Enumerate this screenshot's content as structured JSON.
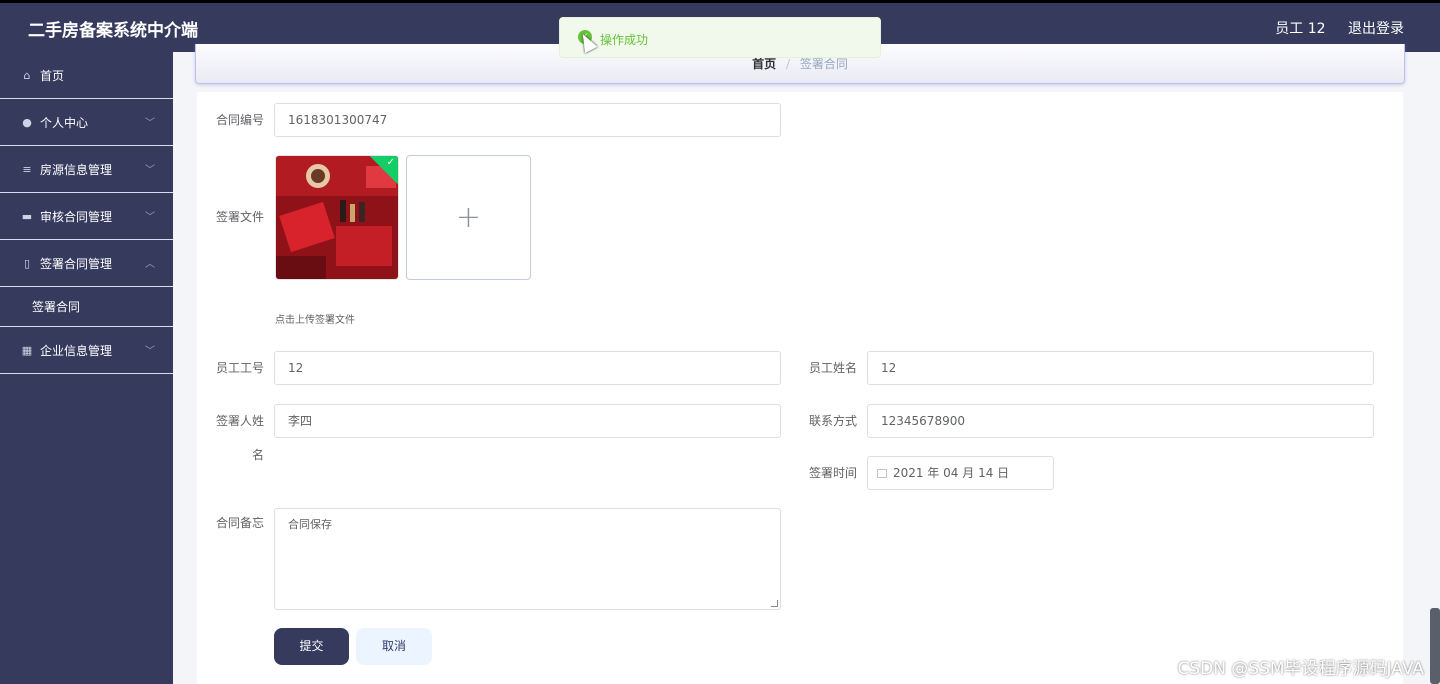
{
  "app": {
    "title": "二手房备案系统中介端"
  },
  "header": {
    "user": "员工 12",
    "logout": "退出登录"
  },
  "toast": {
    "message": "操作成功"
  },
  "sidebar": {
    "items": [
      {
        "label": "首页",
        "icon": "home-icon"
      },
      {
        "label": "个人中心",
        "icon": "user-icon"
      },
      {
        "label": "房源信息管理",
        "icon": "list-icon"
      },
      {
        "label": "审核合同管理",
        "icon": "briefcase-icon"
      },
      {
        "label": "签署合同管理",
        "icon": "microphone-icon"
      },
      {
        "label": "企业信息管理",
        "icon": "grid-icon"
      }
    ],
    "submenu": {
      "label": "签署合同"
    }
  },
  "breadcrumb": {
    "home": "首页",
    "separator": "/",
    "current": "签署合同"
  },
  "form": {
    "contract_no": {
      "label": "合同编号",
      "value": "1618301300747"
    },
    "sign_file": {
      "label": "签署文件",
      "tip": "点击上传签署文件"
    },
    "employee_no": {
      "label": "员工工号",
      "value": "12"
    },
    "employee_name": {
      "label": "员工姓名",
      "value": "12"
    },
    "signer_name": {
      "label_line1": "签署人姓",
      "label_line2": "名",
      "value": "李四"
    },
    "contact": {
      "label": "联系方式",
      "value": "12345678900"
    },
    "sign_time": {
      "label": "签署时间",
      "value": "2021 年 04 月 14 日"
    },
    "remark": {
      "label": "合同备忘",
      "value": "合同保存"
    },
    "submit": "提交",
    "cancel": "取消"
  },
  "watermark": "CSDN @SSM毕设程序源码JAVA",
  "colors": {
    "sidebar_bg": "#363b5e",
    "success": "#67c23a",
    "submit_bg": "#363b5e"
  }
}
